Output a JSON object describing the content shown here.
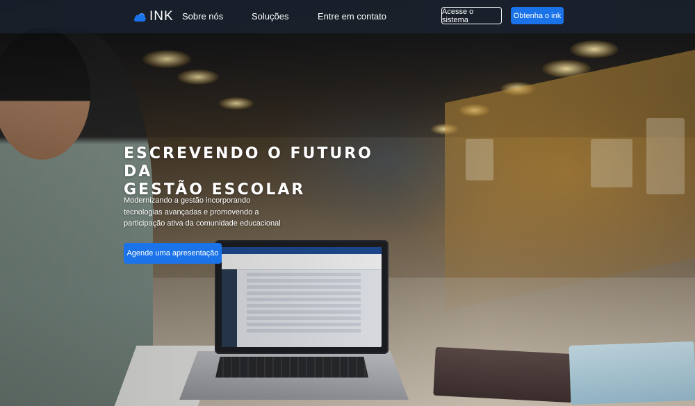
{
  "nav": {
    "logo_text": "INK",
    "links": [
      {
        "label": "Sobre nós"
      },
      {
        "label": "Soluções"
      },
      {
        "label": "Entre em contato"
      }
    ],
    "login_button": "Acesse o sistema",
    "cta_button": "Obtenha o ink"
  },
  "hero": {
    "title_lines": [
      "ESCREVENDO O FUTURO DA",
      "GESTÃO ESCOLAR"
    ],
    "subtitle_lines": [
      "Modernizando a gestão incorporando",
      "tecnologias avançadas e promovendo a",
      "participação ativa da comunidade educacional"
    ],
    "cta_button": "Agende uma apresentação"
  },
  "colors": {
    "accent": "#1a73e8",
    "navbar_bg": "#161e2c"
  },
  "icons": {
    "logo": "ink-cloud-logo-icon"
  }
}
